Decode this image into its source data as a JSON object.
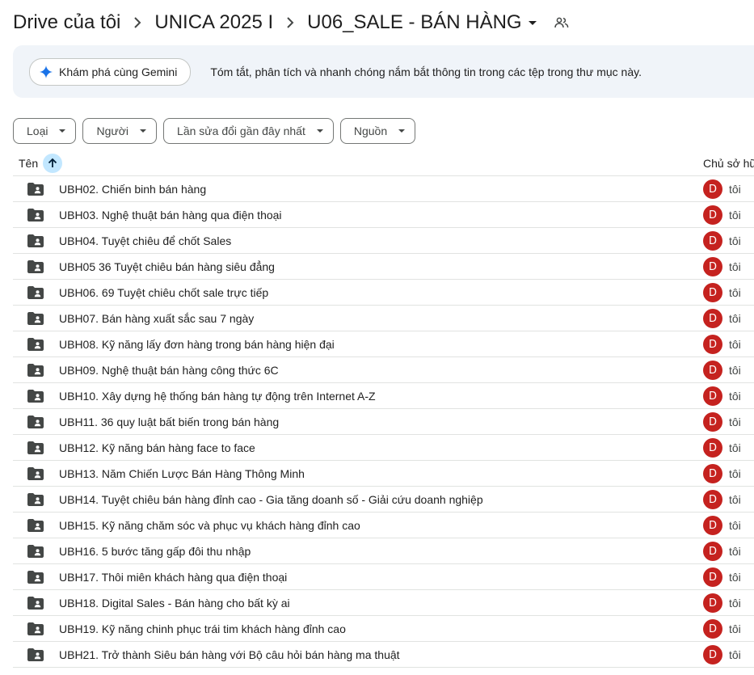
{
  "breadcrumb": {
    "root": "Drive của tôi",
    "parent": "UNICA 2025 I",
    "current": "U06_SALE - BÁN HÀNG"
  },
  "icons": {
    "separator": "chevron-right-icon",
    "current_dropdown": "arrow-drop-down-icon",
    "shared": "people-icon",
    "gemini": "gemini-spark-icon",
    "sort": "arrow-upward-icon",
    "folder": "shared-folder-icon"
  },
  "gemini": {
    "button_label": "Khám phá cùng Gemini",
    "description": "Tóm tắt, phân tích và nhanh chóng nắm bắt thông tin trong các tệp trong thư mục này."
  },
  "filters": [
    "Loại",
    "Người",
    "Lần sửa đổi gần đây nhất",
    "Nguồn"
  ],
  "table": {
    "col_name": "Tên",
    "col_owner": "Chủ sở hữ",
    "rows": [
      {
        "name": "UBH02. Chiến binh bán hàng",
        "owner_initial": "D",
        "owner": "tôi"
      },
      {
        "name": "UBH03. Nghệ thuật bán hàng qua điện thoại",
        "owner_initial": "D",
        "owner": "tôi"
      },
      {
        "name": "UBH04. Tuyệt chiêu để chốt Sales",
        "owner_initial": "D",
        "owner": "tôi"
      },
      {
        "name": "UBH05  36 Tuyệt chiêu bán hàng siêu đẳng",
        "owner_initial": "D",
        "owner": "tôi"
      },
      {
        "name": "UBH06. 69 Tuyệt chiêu chốt sale trực tiếp",
        "owner_initial": "D",
        "owner": "tôi"
      },
      {
        "name": "UBH07. Bán hàng xuất sắc sau 7 ngày",
        "owner_initial": "D",
        "owner": "tôi"
      },
      {
        "name": "UBH08. Kỹ năng lấy đơn hàng trong bán hàng hiện đại",
        "owner_initial": "D",
        "owner": "tôi"
      },
      {
        "name": "UBH09. Nghệ thuật bán hàng công thức 6C",
        "owner_initial": "D",
        "owner": "tôi"
      },
      {
        "name": "UBH10. Xây dựng hệ thống bán hàng tự động trên Internet A-Z",
        "owner_initial": "D",
        "owner": "tôi"
      },
      {
        "name": "UBH11. 36 quy luật bất biến trong bán hàng",
        "owner_initial": "D",
        "owner": "tôi"
      },
      {
        "name": "UBH12. Kỹ năng bán hàng face to face",
        "owner_initial": "D",
        "owner": "tôi"
      },
      {
        "name": "UBH13. Năm Chiến Lược Bán Hàng Thông Minh",
        "owner_initial": "D",
        "owner": "tôi"
      },
      {
        "name": "UBH14. Tuyệt chiêu bán hàng đỉnh cao - Gia tăng doanh số - Giải cứu doanh nghiệp",
        "owner_initial": "D",
        "owner": "tôi"
      },
      {
        "name": "UBH15. Kỹ năng chăm sóc và phục vụ khách hàng đỉnh cao",
        "owner_initial": "D",
        "owner": "tôi"
      },
      {
        "name": "UBH16. 5 bước tăng gấp đôi thu nhập",
        "owner_initial": "D",
        "owner": "tôi"
      },
      {
        "name": "UBH17. Thôi miên khách hàng qua điện thoại",
        "owner_initial": "D",
        "owner": "tôi"
      },
      {
        "name": "UBH18. Digital Sales - Bán hàng cho bất kỳ ai",
        "owner_initial": "D",
        "owner": "tôi"
      },
      {
        "name": "UBH19. Kỹ năng chinh phục trái tim khách hàng đỉnh cao",
        "owner_initial": "D",
        "owner": "tôi"
      },
      {
        "name": "UBH21. Trở thành Siêu bán hàng với Bộ câu hỏi bán hàng ma thuật",
        "owner_initial": "D",
        "owner": "tôi"
      }
    ]
  },
  "colors": {
    "avatar": "#c5221f",
    "folder": "#444746",
    "sort_button": "#c2e7ff",
    "banner": "#f0f4f9"
  }
}
